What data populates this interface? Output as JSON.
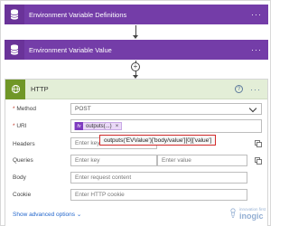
{
  "cards": [
    {
      "title": "Environment Variable Definitions",
      "more": "···"
    },
    {
      "title": "Environment Variable Value",
      "more": "···"
    }
  ],
  "connector": {
    "add_symbol": "+"
  },
  "http": {
    "title": "HTTP",
    "help": "?",
    "more": "···",
    "fields": {
      "method": {
        "label": "Method",
        "required_mark": "*",
        "value": "POST"
      },
      "uri": {
        "label": "URI",
        "required_mark": "*",
        "token_fx": "fx",
        "token_label": "outputs(...)",
        "token_remove": "×"
      },
      "headers": {
        "label": "Headers",
        "key_placeholder": "Enter key"
      },
      "queries": {
        "label": "Queries",
        "key_placeholder": "Enter key",
        "value_placeholder": "Enter value"
      },
      "body": {
        "label": "Body",
        "placeholder": "Enter request content"
      },
      "cookie": {
        "label": "Cookie",
        "placeholder": "Enter HTTP cookie"
      }
    },
    "tooltip": "outputs('EVValue')['body/value'][0]['value']",
    "advanced": "Show advanced options",
    "advanced_chevron": "⌄"
  },
  "watermark": {
    "small": "innovation first",
    "brand": "inogic"
  },
  "colors": {
    "action_purple": "#743da8",
    "http_green": "#709727",
    "http_header_bg": "#e3eed7",
    "tooltip_border": "#d22b2b"
  }
}
